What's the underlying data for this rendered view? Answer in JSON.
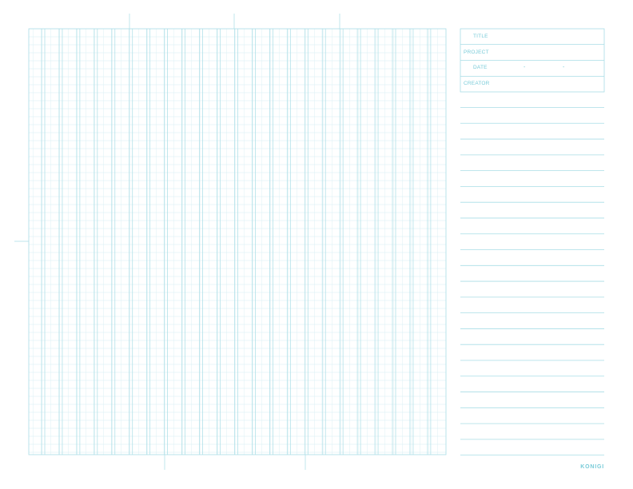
{
  "colors": {
    "line": "#a8dde6",
    "line_light": "#d4eef2",
    "text": "#78cbd8"
  },
  "header": {
    "title_label": "TITLE",
    "project_label": "PROJECT",
    "date_label": "DATE",
    "date_separator": "-",
    "creator_label": "CREATOR"
  },
  "brand": {
    "name": "KONIGI"
  }
}
